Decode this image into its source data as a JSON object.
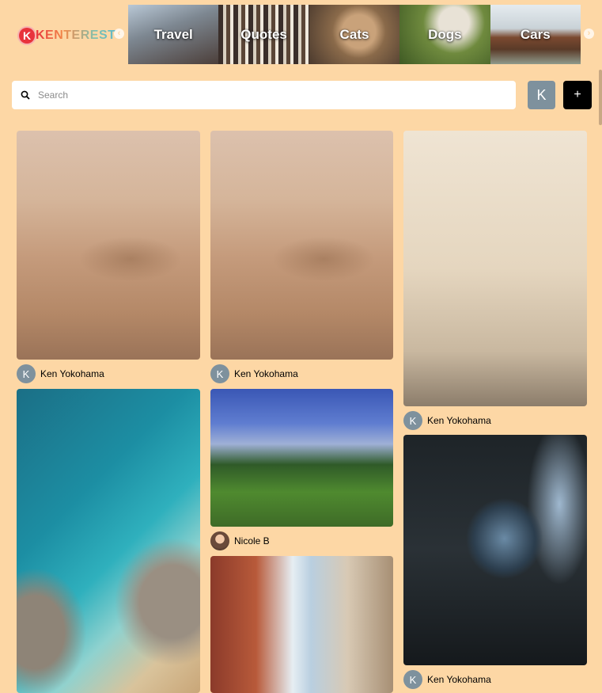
{
  "logo": {
    "mark": "K",
    "text": "KENTEREST"
  },
  "categories": [
    {
      "label": "Travel"
    },
    {
      "label": "Quotes"
    },
    {
      "label": "Cats"
    },
    {
      "label": "Dogs"
    },
    {
      "label": "Cars"
    }
  ],
  "nav": {
    "prev_icon": "‹",
    "next_icon": "›"
  },
  "search": {
    "placeholder": "Search",
    "value": ""
  },
  "user_button": {
    "label": "K"
  },
  "add_button": {
    "label": "+"
  },
  "pins": [
    {
      "author": "Ken Yokohama",
      "avatar": "K",
      "image": "pyramids-aerial"
    },
    {
      "author": "Ken Yokohama",
      "avatar": "K",
      "image": "coastline-aerial"
    },
    {
      "author": "Ken Yokohama",
      "avatar": "K",
      "image": "pyramids-aerial"
    },
    {
      "author": "Nicole B",
      "avatar": "",
      "image": "garden-path-with-airplane"
    },
    {
      "author": "",
      "avatar": "",
      "image": "venice-street"
    },
    {
      "author": "Ken Yokohama",
      "avatar": "K",
      "image": "white-building-with-plants"
    },
    {
      "author": "Ken Yokohama",
      "avatar": "K",
      "image": "desk-setup"
    }
  ],
  "colors": {
    "background": "#fdd7a5",
    "avatar": "#7e919d",
    "add_button": "#000000"
  }
}
